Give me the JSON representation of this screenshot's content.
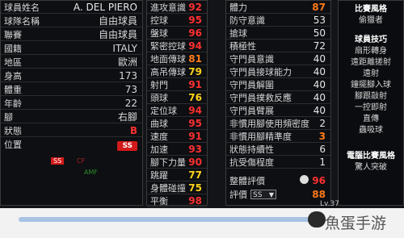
{
  "player": {
    "name_label": "球員姓名",
    "name": "A. DEL PIERO",
    "registered_name_label": "球隊名稱",
    "registered_name": "自由球員",
    "club_label": "聯賽",
    "club": "自由球員",
    "nation_label": "國籍",
    "nation": "ITALY",
    "region_label": "地區",
    "region": "歐洲",
    "height_label": "身高",
    "height": "173",
    "weight_label": "體重",
    "weight": "73",
    "age_label": "年齡",
    "age": "22",
    "foot_label": "腳",
    "foot": "右腳",
    "condition_label": "狀態",
    "condition": "B",
    "position_label": "位置",
    "position": "SS",
    "mini_badge": "SS",
    "mini_cf": "CF",
    "mini_amf": "AMF"
  },
  "attributes_mid": [
    {
      "label": "進攻意識",
      "value": "92"
    },
    {
      "label": "控球",
      "value": "95"
    },
    {
      "label": "盤球",
      "value": "96"
    },
    {
      "label": "緊密控球",
      "value": "94"
    },
    {
      "label": "地面傳球",
      "value": "81"
    },
    {
      "label": "高吊傳球",
      "value": "79"
    },
    {
      "label": "射門",
      "value": "91"
    },
    {
      "label": "頭球",
      "value": "76"
    },
    {
      "label": "定位球",
      "value": "94"
    },
    {
      "label": "曲球",
      "value": "95"
    },
    {
      "label": "速度",
      "value": "91"
    },
    {
      "label": "加速",
      "value": "93"
    },
    {
      "label": "腳下力量",
      "value": "90"
    },
    {
      "label": "跳躍",
      "value": "77"
    },
    {
      "label": "身體碰撞",
      "value": "75"
    },
    {
      "label": "平衡",
      "value": "98"
    }
  ],
  "attributes_right": [
    {
      "label": "體力",
      "value": "87"
    },
    {
      "label": "防守意識",
      "value": "53"
    },
    {
      "label": "搶球",
      "value": "50"
    },
    {
      "label": "積極性",
      "value": "72"
    },
    {
      "label": "守門員意識",
      "value": "40"
    },
    {
      "label": "守門員接球能力",
      "value": "40"
    },
    {
      "label": "守門員解圍",
      "value": "40"
    },
    {
      "label": "守門員撲救反應",
      "value": "40"
    },
    {
      "label": "守門員臂展",
      "value": "40"
    },
    {
      "label": "非慣用腳使用頻密度",
      "value": "2"
    },
    {
      "label": "非慣用腳精準度",
      "value": "3"
    },
    {
      "label": "狀態持續性",
      "value": "6"
    },
    {
      "label": "抗受傷程度",
      "value": "1"
    }
  ],
  "rating": {
    "overall_label": "整體評價",
    "overall_value": "96",
    "eval_label": "評價",
    "eval_select": "SS",
    "eval_value": "88"
  },
  "sidebar": {
    "section1_title": "比賽風格",
    "section1_items": [
      "偷獵者"
    ],
    "section2_title": "球員技巧",
    "section2_items": [
      "扇形轉身",
      "遠距離搓射",
      "遠射",
      "鐘擺腳入球",
      "腳跟敲射",
      "一控即射",
      "直傳",
      "蟲吸球"
    ],
    "section3_title": "電腦比賽風格",
    "section3_items": [
      "驚人突破"
    ]
  },
  "footer": {
    "level_text": "Lv.37",
    "watermark": "魚蛋手游",
    "level_progress": 0.97
  },
  "colors": {
    "red": "#ff3030",
    "orange": "#ff7a1a",
    "yellow": "#ffd21a",
    "badge": "#d31a1a"
  }
}
